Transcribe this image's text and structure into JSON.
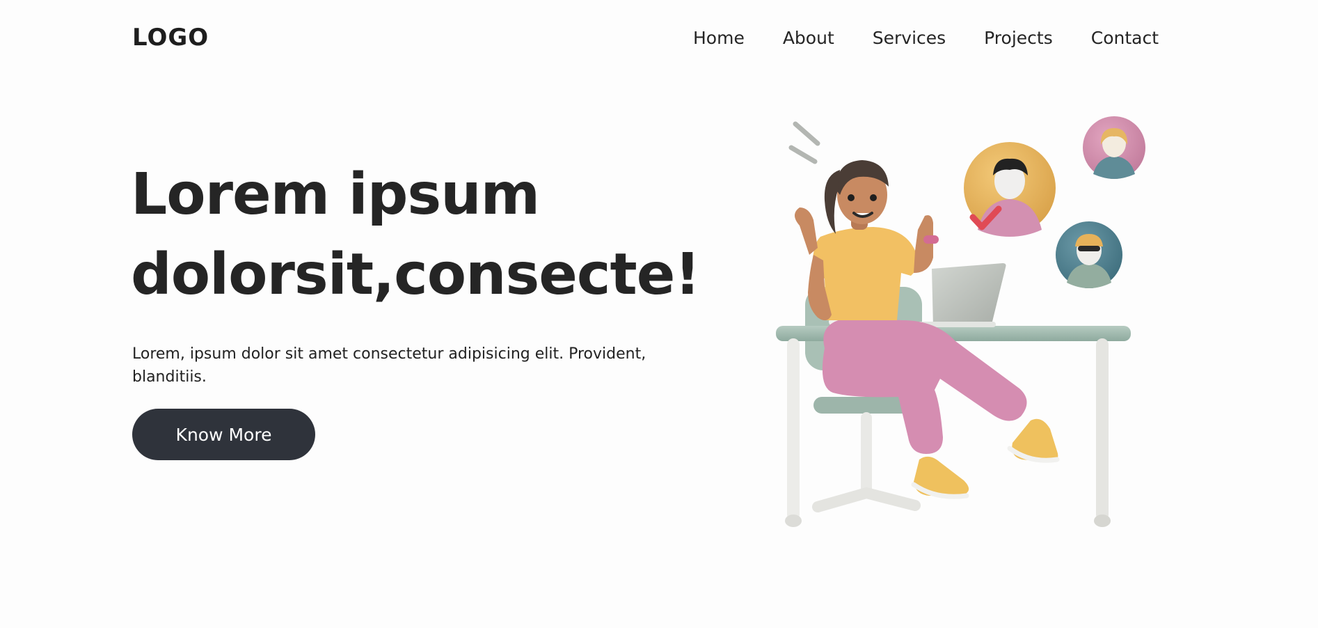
{
  "header": {
    "logo": "LOGO",
    "nav": [
      "Home",
      "About",
      "Services",
      "Projects",
      "Contact"
    ]
  },
  "hero": {
    "title_line1": "Lorem ipsum",
    "title_line2": "dolorsit,consecte!",
    "description": "Lorem, ipsum dolor sit amet consectetur adipisicing elit. Provident, blanditiis.",
    "cta_label": "Know More"
  },
  "colors": {
    "background": "#fdfdfd",
    "text": "#252525",
    "button": "#2f333b",
    "button_text": "#ffffff",
    "desk": "#9fb8ad",
    "shirt": "#f2c063",
    "pants": "#d48bb0",
    "avatar_orange": "#e7b25a",
    "avatar_pink": "#cf8aa8",
    "avatar_teal": "#4d7f8e"
  },
  "illustration": {
    "name": "woman-at-desk-with-laptop-illustration",
    "avatars": [
      "avatar-selected-icon",
      "avatar-pink-icon",
      "avatar-teal-icon"
    ]
  }
}
